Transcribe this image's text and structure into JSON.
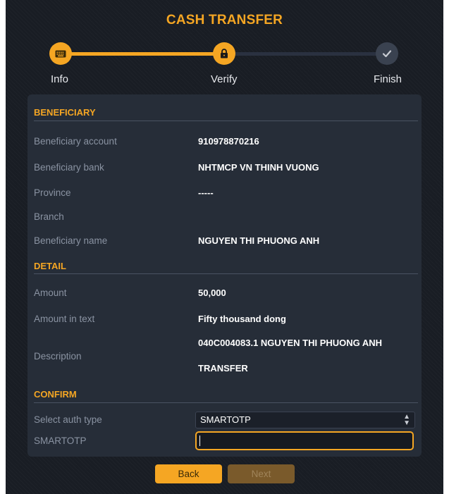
{
  "header": {
    "title": "CASH TRANSFER"
  },
  "stepper": {
    "steps": [
      {
        "label": "Info",
        "icon": "keyboard-icon",
        "state": "complete"
      },
      {
        "label": "Verify",
        "icon": "lock-icon",
        "state": "active"
      },
      {
        "label": "Finish",
        "icon": "check-icon",
        "state": "pending"
      }
    ]
  },
  "beneficiary": {
    "title": "BENEFICIARY",
    "account_label": "Beneficiary account",
    "account_value": "910978870216",
    "bank_label": "Beneficiary bank",
    "bank_value": "NHTMCP VN THINH VUONG",
    "province_label": "Province",
    "province_value": "-----",
    "branch_label": "Branch",
    "branch_value": "",
    "name_label": "Beneficiary name",
    "name_value": "NGUYEN THI PHUONG ANH"
  },
  "detail": {
    "title": "DETAIL",
    "amount_label": "Amount",
    "amount_value": "50,000",
    "amount_text_label": "Amount in text",
    "amount_text_value": "Fifty thousand  dong",
    "description_label": "Description",
    "description_line1": "040C004083.1 NGUYEN THI PHUONG ANH",
    "description_line2": "TRANSFER"
  },
  "confirm": {
    "title": "CONFIRM",
    "auth_type_label": "Select auth type",
    "auth_type_value": "SMARTOTP",
    "otp_label": "SMARTOTP",
    "otp_value": ""
  },
  "actions": {
    "back_label": "Back",
    "next_label": "Next"
  },
  "colors": {
    "accent": "#f5a623",
    "background": "#191d24",
    "card": "#262d38"
  }
}
